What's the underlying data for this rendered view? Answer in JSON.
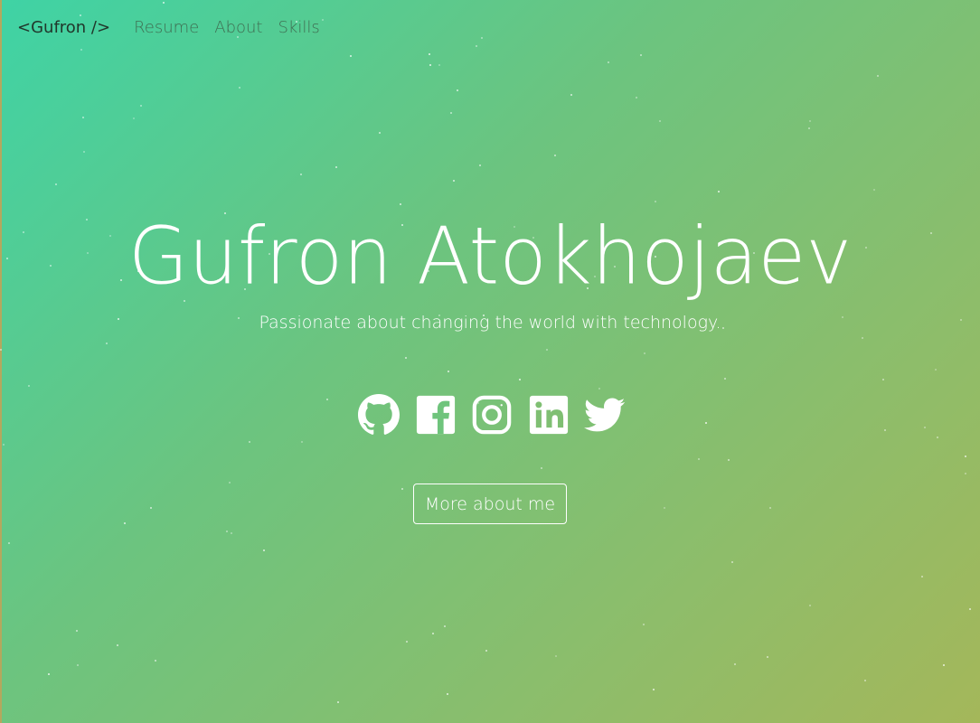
{
  "nav": {
    "brand": "<Gufron />",
    "links": [
      {
        "label": "Resume"
      },
      {
        "label": "About"
      },
      {
        "label": "Skills"
      }
    ]
  },
  "hero": {
    "name": "Gufron Atokhojaev",
    "tagline": "Passionate about changing the world with technology."
  },
  "socials": [
    {
      "icon": "github-icon"
    },
    {
      "icon": "facebook-icon"
    },
    {
      "icon": "instagram-icon"
    },
    {
      "icon": "linkedin-icon"
    },
    {
      "icon": "twitter-icon"
    }
  ],
  "cta": {
    "label": "More about me"
  },
  "colors": {
    "gradient_start": "#3fd3a5",
    "gradient_end": "#a4b75a",
    "text": "#ffffff",
    "nav_link": "#3f6e52",
    "brand": "#21372b"
  }
}
